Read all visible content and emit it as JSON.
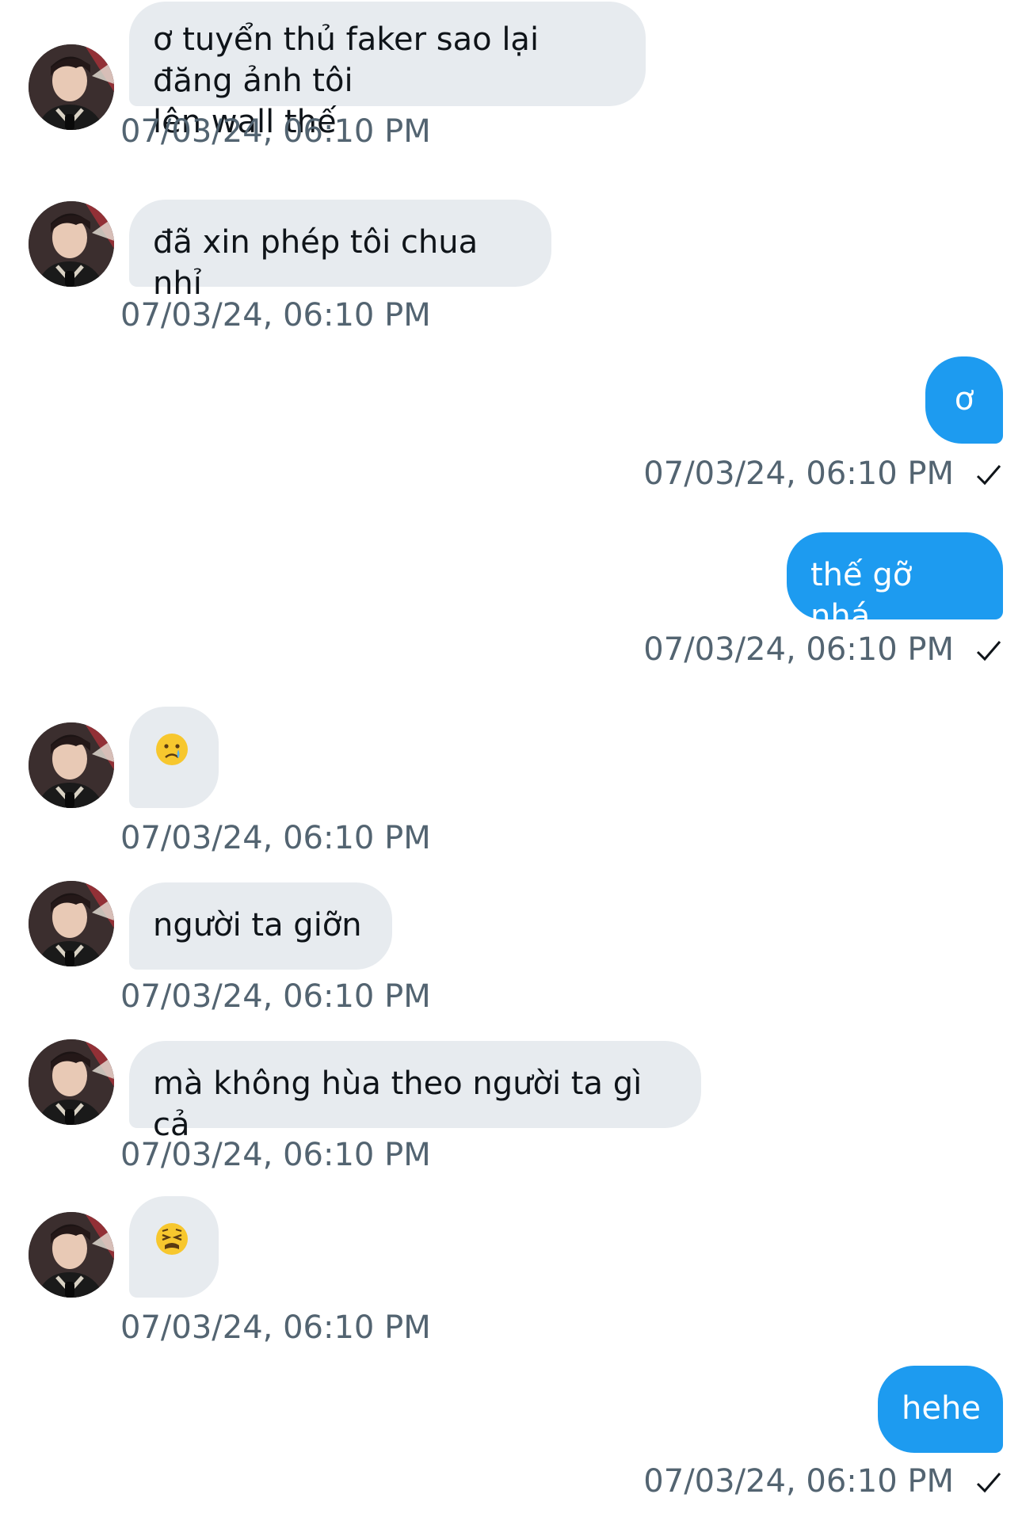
{
  "conversation": {
    "messages": [
      {
        "direction": "in",
        "text": "ơ tuyển thủ faker sao lại đăng ảnh tôi\nlên wall thế",
        "timestamp": "07/03/24, 06:10 PM"
      },
      {
        "direction": "in",
        "text": "đã xin phép tôi chua nhỉ",
        "timestamp": "07/03/24, 06:10 PM"
      },
      {
        "direction": "out",
        "text": "ơ",
        "timestamp": "07/03/24, 06:10 PM",
        "status_icon": "check-icon"
      },
      {
        "direction": "out",
        "text": "thế gỡ nhá",
        "timestamp": "07/03/24, 06:10 PM",
        "status_icon": "check-icon"
      },
      {
        "direction": "in",
        "text": "",
        "emoji": "crying-face-emoji",
        "timestamp": "07/03/24, 06:10 PM"
      },
      {
        "direction": "in",
        "text": "người ta giỡn",
        "timestamp": "07/03/24, 06:10 PM"
      },
      {
        "direction": "in",
        "text": "mà không hùa theo người ta gì cả",
        "timestamp": "07/03/24, 06:10 PM"
      },
      {
        "direction": "in",
        "text": "",
        "emoji": "weary-face-emoji",
        "timestamp": "07/03/24, 06:10 PM"
      },
      {
        "direction": "out",
        "text": "hehe",
        "timestamp": "07/03/24, 06:10 PM",
        "status_icon": "check-icon"
      }
    ]
  },
  "colors": {
    "incoming_bubble": "#e7ebef",
    "outgoing_bubble": "#1d9bf0",
    "timestamp": "#536471"
  }
}
